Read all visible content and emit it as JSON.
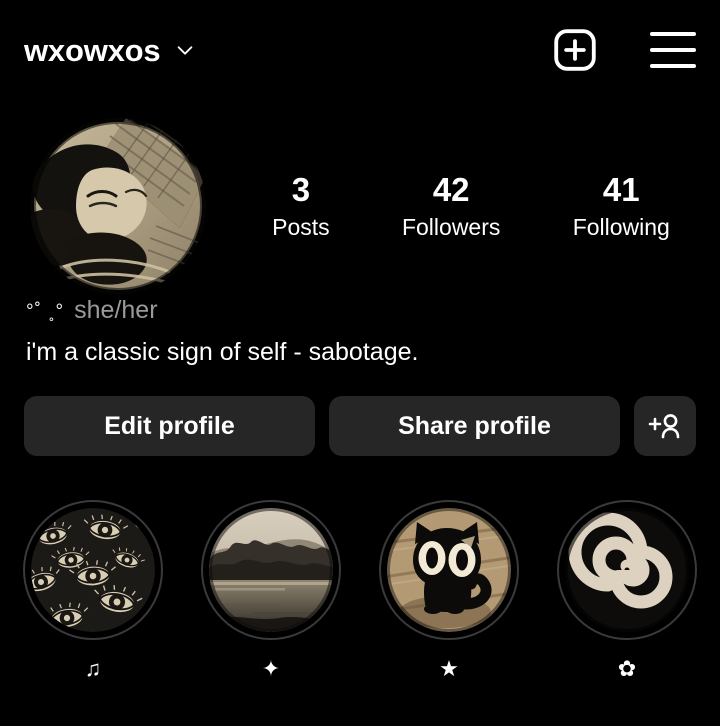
{
  "app": "instagram-profile",
  "theme": {
    "background": "#000000",
    "button_bg": "#262626",
    "text": "#ffffff",
    "muted_text": "#9a9a9a",
    "ring": "#3a3a3a"
  },
  "header": {
    "username": "wxowxos",
    "account_switch_icon": "chevron-down-icon",
    "new_post_icon": "plus-square-icon",
    "menu_icon": "hamburger-menu-icon"
  },
  "profile": {
    "avatar_alt": "profile-picture",
    "stats": [
      {
        "count": "3",
        "label": "Posts"
      },
      {
        "count": "42",
        "label": "Followers"
      },
      {
        "count": "41",
        "label": "Following"
      }
    ],
    "decoration": "°˚ ˳°",
    "pronouns": "she/her",
    "bio": "i'm a classic sign of self - sabotage."
  },
  "actions": {
    "edit_profile": "Edit profile",
    "share_profile": "Share profile",
    "discover_people_icon": "add-person-icon"
  },
  "highlights": [
    {
      "name": "eyes",
      "label": "♫"
    },
    {
      "name": "landscape",
      "label": "✦"
    },
    {
      "name": "cat",
      "label": "★"
    },
    {
      "name": "spiral",
      "label": "✿"
    }
  ]
}
